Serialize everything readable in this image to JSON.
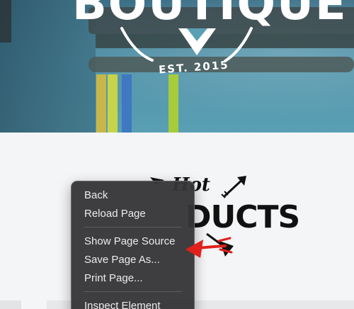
{
  "hero": {
    "title": "BOUTIQUE",
    "established": "EST. 2015"
  },
  "section": {
    "hot_label": "Hot",
    "products_label": "DUCTS"
  },
  "context_menu": {
    "groups": [
      [
        {
          "label": "Back"
        },
        {
          "label": "Reload Page"
        }
      ],
      [
        {
          "label": "Show Page Source"
        },
        {
          "label": "Save Page As..."
        },
        {
          "label": "Print Page..."
        }
      ],
      [
        {
          "label": "Inspect Element"
        }
      ]
    ]
  },
  "annotation": {
    "arrow_color": "#e0201b"
  }
}
